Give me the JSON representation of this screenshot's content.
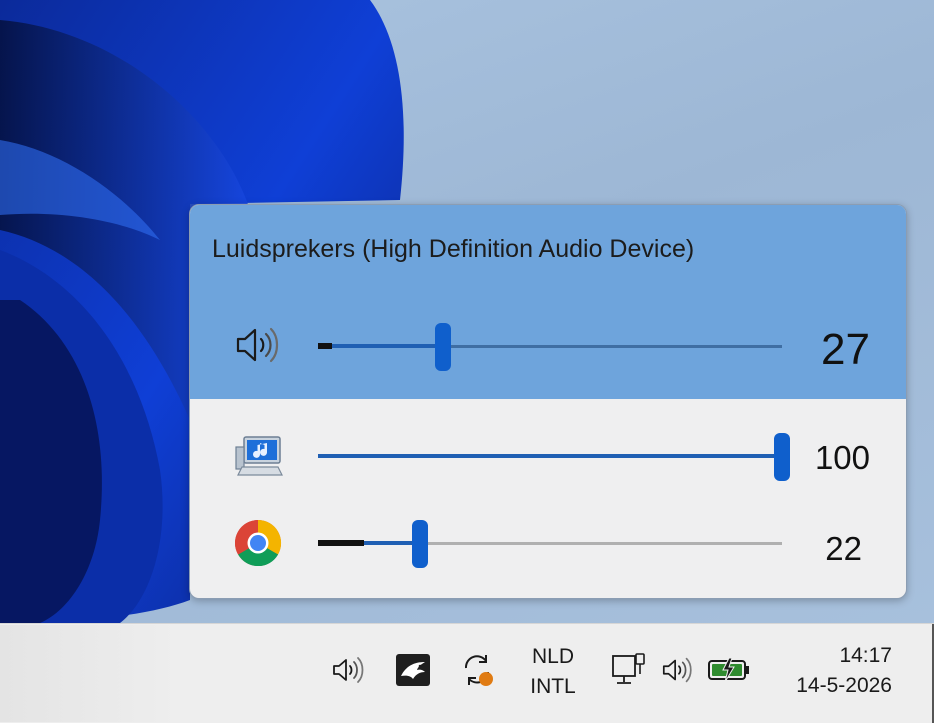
{
  "mixer": {
    "device_title": "Luidsprekers (High Definition Audio Device)",
    "master": {
      "icon": "speaker-icon",
      "level": "27",
      "value": 27,
      "peak": 3
    },
    "apps": [
      {
        "name": "system-sounds",
        "icon": "system-sounds-icon",
        "level": "100",
        "value": 100,
        "peak": 0
      },
      {
        "name": "chrome",
        "icon": "chrome-icon",
        "level": "22",
        "value": 22,
        "peak": 10
      }
    ]
  },
  "taskbar": {
    "tray_icons": [
      "speaker-icon",
      "eagle-app-icon",
      "sync-icon",
      "network-icon",
      "speaker-icon",
      "battery-charging-icon"
    ],
    "language": {
      "line1": "NLD",
      "line2": "INTL"
    },
    "clock": {
      "time": "14:17",
      "date": "14-5-2026"
    }
  },
  "colors": {
    "accent": "#0f5fcc",
    "mixer_header": "#6ea4dc",
    "battery": "#2e8b2e",
    "sync_badge": "#e07b12"
  }
}
